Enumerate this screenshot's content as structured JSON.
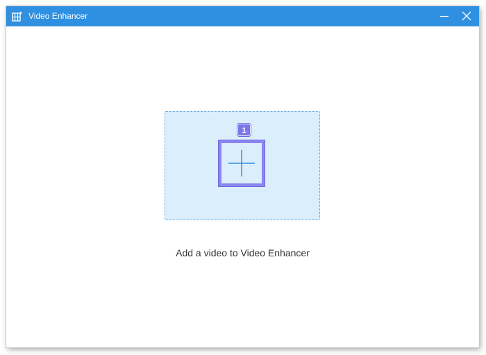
{
  "window": {
    "title": "Video Enhancer",
    "app_icon": "video-enhancer-app-icon",
    "controls": {
      "minimize_icon": "minimize-icon",
      "close_icon": "close-icon"
    },
    "colors": {
      "titlebar": "#2f8fe0",
      "drop_zone_fill": "#dbeefb",
      "drop_zone_border": "#6aaee6",
      "highlight": "#8c86f0"
    }
  },
  "main": {
    "add_icon": "plus-icon",
    "step_badge": "1",
    "hint_text": "Add a video to Video Enhancer"
  }
}
